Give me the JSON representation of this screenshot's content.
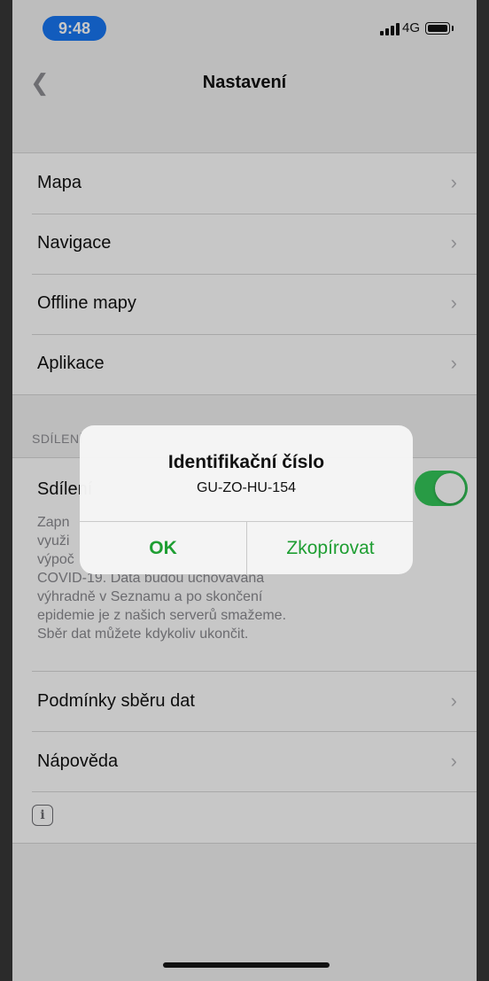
{
  "status_bar": {
    "time": "9:48",
    "network": "4G"
  },
  "nav": {
    "title": "Nastavení"
  },
  "settings": {
    "items": [
      {
        "label": "Mapa"
      },
      {
        "label": "Navigace"
      },
      {
        "label": "Offline mapy"
      },
      {
        "label": "Aplikace"
      }
    ]
  },
  "sharing": {
    "section_header": "SDÍLENÍ",
    "toggle_label": "Sdílení",
    "toggle_on": true,
    "description_visible": "Zapn… využi… výpoč… COVID-19. Data budou uchovávána výhradně v Seznamu a po skončení epidemie je z našich serverů smažeme. Sběr dat můžete kdykoliv ukončit.",
    "description_lines": [
      "Zapn",
      "využi",
      "výpoč",
      "COVID-19. Data budou uchovávána",
      "výhradně v Seznamu a po skončení",
      "epidemie je z našich serverů smažeme.",
      "Sběr dat můžete kdykoliv ukončit."
    ],
    "items": [
      {
        "label": "Podmínky sběru dat"
      },
      {
        "label": "Nápověda"
      }
    ]
  },
  "alert": {
    "title": "Identifikační číslo",
    "message": "GU-ZO-HU-154",
    "ok_label": "OK",
    "copy_label": "Zkopírovat"
  },
  "colors": {
    "accent": "#1e9e32",
    "toggle_on": "#34c759",
    "time_pill": "#1877f2"
  }
}
